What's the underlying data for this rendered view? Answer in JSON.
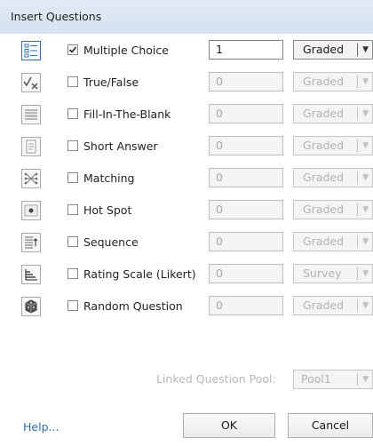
{
  "window": {
    "title": "Insert Questions"
  },
  "questions": [
    {
      "icon": "multiple-choice-icon",
      "label": "Multiple Choice",
      "checked": true,
      "count": "1",
      "grading": "Graded",
      "enabled": true
    },
    {
      "icon": "true-false-icon",
      "label": "True/False",
      "checked": false,
      "count": "0",
      "grading": "Graded",
      "enabled": false
    },
    {
      "icon": "fill-in-the-blank-icon",
      "label": "Fill-In-The-Blank",
      "checked": false,
      "count": "0",
      "grading": "Graded",
      "enabled": false
    },
    {
      "icon": "short-answer-icon",
      "label": "Short Answer",
      "checked": false,
      "count": "0",
      "grading": "Graded",
      "enabled": false
    },
    {
      "icon": "matching-icon",
      "label": "Matching",
      "checked": false,
      "count": "0",
      "grading": "Graded",
      "enabled": false
    },
    {
      "icon": "hot-spot-icon",
      "label": "Hot Spot",
      "checked": false,
      "count": "0",
      "grading": "Graded",
      "enabled": false
    },
    {
      "icon": "sequence-icon",
      "label": "Sequence",
      "checked": false,
      "count": "0",
      "grading": "Graded",
      "enabled": false
    },
    {
      "icon": "rating-scale-icon",
      "label": "Rating Scale (Likert)",
      "checked": false,
      "count": "0",
      "grading": "Survey",
      "enabled": false
    },
    {
      "icon": "random-question-icon",
      "label": "Random Question",
      "checked": false,
      "count": "0",
      "grading": "Graded",
      "enabled": false
    }
  ],
  "pool": {
    "label": "Linked Question Pool:",
    "value": "Pool1"
  },
  "footer": {
    "help": "Help...",
    "ok": "OK",
    "cancel": "Cancel"
  },
  "colors": {
    "title_bar": "#d9e4f1",
    "link": "#2a6ebb",
    "disabled_text": "#b3b3b3",
    "accent": "#2f70b5"
  }
}
